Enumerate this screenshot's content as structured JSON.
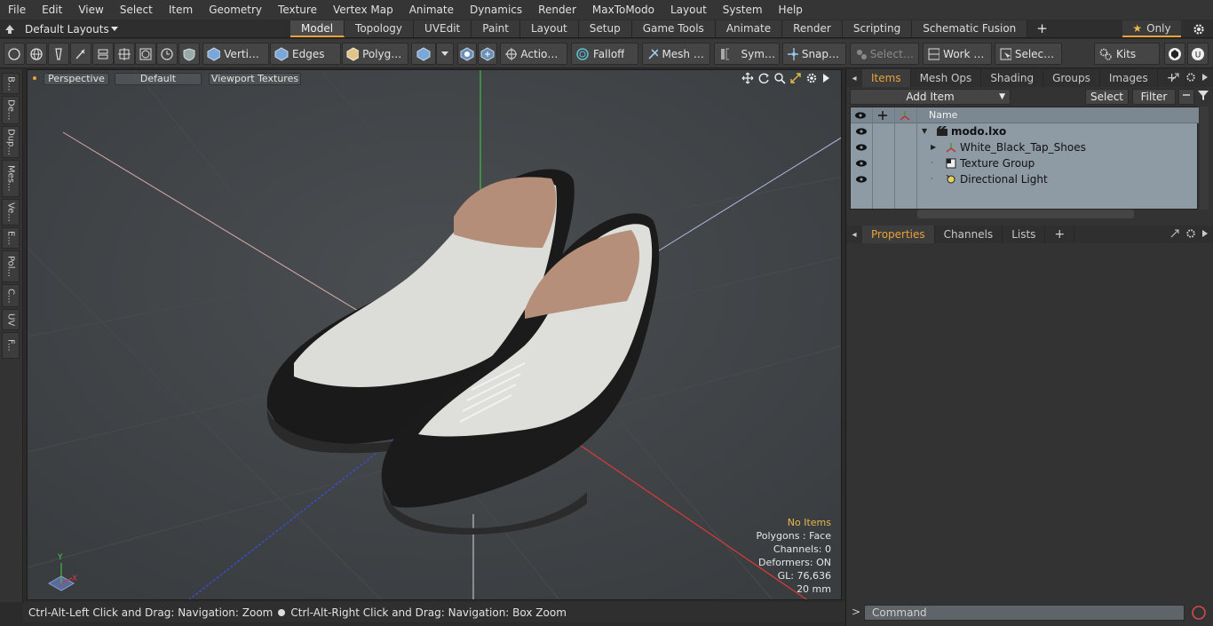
{
  "menu": [
    "File",
    "Edit",
    "View",
    "Select",
    "Item",
    "Geometry",
    "Texture",
    "Vertex Map",
    "Animate",
    "Dynamics",
    "Render",
    "MaxToModo",
    "Layout",
    "System",
    "Help"
  ],
  "layout": {
    "default_layouts": "Default Layouts",
    "tabs": [
      "Model",
      "Topology",
      "UVEdit",
      "Paint",
      "Layout",
      "Setup",
      "Game Tools",
      "Animate",
      "Render",
      "Scripting",
      "Schematic Fusion"
    ],
    "active_tab": "Model",
    "add_tab": "+",
    "only_label": "Only"
  },
  "toolbar": {
    "vertices": "Vertices",
    "edges": "Edges",
    "polygons": "Polygons",
    "action": "Action ...",
    "falloff": "Falloff",
    "mesh": "Mesh C ...",
    "symmetry": "Symm ...",
    "snapping": "Snapping",
    "select_t": "Select T...",
    "work_plane": "Work Pl...",
    "selection": "Selecti ...",
    "kits": "Kits"
  },
  "left_tabs": [
    "B...",
    "De...",
    "Dup...",
    "Mes...",
    "Ve...",
    "E...",
    "Pol...",
    "C...",
    "UV",
    "F..."
  ],
  "viewport": {
    "perspective": "Perspective",
    "default": "Default",
    "textures": "Viewport Textures",
    "stats": {
      "no_items": "No Items",
      "polygons": "Polygons : Face",
      "channels": "Channels: 0",
      "deformers": "Deformers: ON",
      "gl": "GL: 76,636",
      "scale": "20 mm"
    },
    "axis_y": "Y",
    "axis_x": "X"
  },
  "status": {
    "left": "Ctrl-Alt-Left Click and Drag: Navigation: Zoom",
    "right": "Ctrl-Alt-Right Click and Drag: Navigation: Box Zoom"
  },
  "items_panel": {
    "tabs": [
      "Items",
      "Mesh Ops",
      "Shading",
      "Groups",
      "Images"
    ],
    "active_tab": "Items",
    "add_tab": "+",
    "add_item": "Add Item",
    "select": "Select",
    "filter": "Filter",
    "name_header": "Name",
    "tree": [
      {
        "label": "modo.lxo",
        "level": 0,
        "icon": "scene-icon"
      },
      {
        "label": "White_Black_Tap_Shoes",
        "level": 1,
        "icon": "mesh-icon"
      },
      {
        "label": "Texture Group",
        "level": 1,
        "icon": "texture-icon"
      },
      {
        "label": "Directional Light",
        "level": 1,
        "icon": "light-icon"
      }
    ]
  },
  "properties_panel": {
    "tabs": [
      "Properties",
      "Channels",
      "Lists"
    ],
    "active_tab": "Properties",
    "add_tab": "+"
  },
  "command": {
    "placeholder": "Command"
  },
  "colors": {
    "accent": "#e8a33a",
    "viewport_bg": "#404447",
    "list_bg": "#8e9aa4"
  }
}
